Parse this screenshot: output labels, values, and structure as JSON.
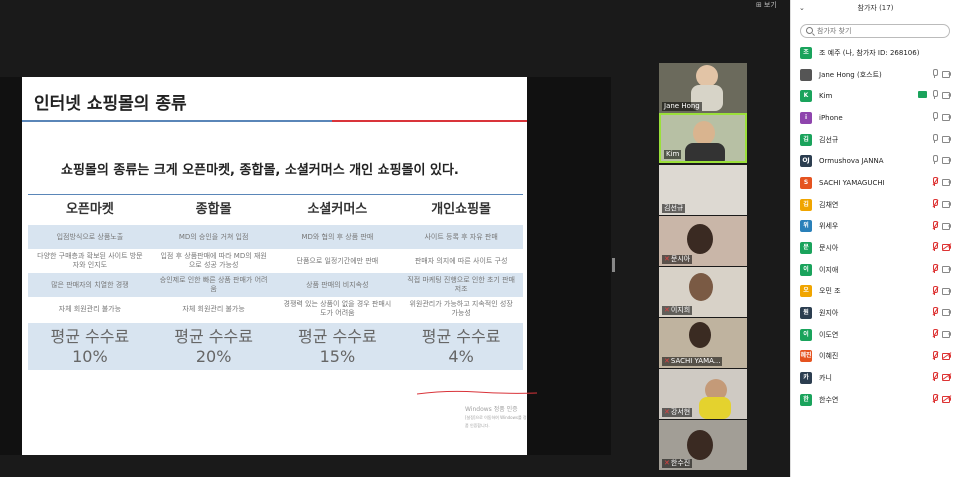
{
  "toolbar": {
    "view_label": "보기",
    "view_icon": "grid-icon"
  },
  "slide": {
    "title": "인터넷 쇼핑몰의 종류",
    "subtitle": "쇼핑몰의 종류는 크게 오픈마켓, 종합몰, 소셜커머스 개인 쇼핑몰이 있다.",
    "columns": [
      "오픈마켓",
      "종합몰",
      "소셜커머스",
      "개인쇼핑몰"
    ],
    "rows": [
      [
        "입점방식으로 상품노출",
        "MD의 승인을 거쳐 입점",
        "MD와 협의 후 상품 판매",
        "사이트 등록 후 자유 판매"
      ],
      [
        "다양한 구매층과 확보된 사이트 방문자와 인지도",
        "입점 후 상품판매에 따라 MD의 재원으로 성공 가능성",
        "단품으로 일정기간에만 판매",
        "판매자 의지에 따른 사이트 구성"
      ],
      [
        "많은 판매자의 치열한 경쟁",
        "승인제로 인한 빠른 상품 판매가 어려움",
        "상품 판매의 비지속성",
        "직접 마케팅 진행으로 인한 초기 판매 저조"
      ],
      [
        "자체 회원관리 불가능",
        "자체 회원관리 불가능",
        "경쟁력 있는 상품이 없을 경우 판매시도가 어려움",
        "위원관리가 가능하고 지속적인 성장 가능성"
      ]
    ],
    "fee_label": "평균 수수료",
    "fees": [
      "10%",
      "20%",
      "15%",
      "4%"
    ],
    "watermark_title": "Windows 정품 인증",
    "watermark_sub": "[설정]으로 이동하여 Windows를 정품 인증합니다.",
    "accent_blue": "#5a86b8",
    "accent_red": "#d9343a",
    "shade": "#d8e4f0"
  },
  "video_tiles": [
    {
      "name": "Jane Hong",
      "muted": false,
      "active": false
    },
    {
      "name": "Kim",
      "muted": false,
      "active": true
    },
    {
      "name": "김선규",
      "muted": false,
      "active": false
    },
    {
      "name": "문시아",
      "muted": true,
      "active": false
    },
    {
      "name": "이지희",
      "muted": true,
      "active": false
    },
    {
      "name": "SACHI YAMA...",
      "muted": true,
      "active": false
    },
    {
      "name": "강서현",
      "muted": true,
      "active": false
    },
    {
      "name": "한수진",
      "muted": true,
      "active": false
    }
  ],
  "panel": {
    "title": "참가자 (17)",
    "search_placeholder": "참가자 찾기",
    "participants": [
      {
        "initial": "조",
        "name": "조 예주 (나, 참가자 ID: 268106)",
        "color": "#1aa35c",
        "mic": "none",
        "cam": "none"
      },
      {
        "initial": "",
        "name": "Jane Hong (호스트)",
        "color": "#555555",
        "mic": "on",
        "cam": "on"
      },
      {
        "initial": "K",
        "name": "Kim",
        "color": "#1aa35c",
        "mic": "on",
        "cam": "on",
        "share": true
      },
      {
        "initial": "i",
        "name": "iPhone",
        "color": "#8e44ad",
        "mic": "on",
        "cam": "on"
      },
      {
        "initial": "김",
        "name": "김선규",
        "color": "#1aa35c",
        "mic": "on",
        "cam": "on"
      },
      {
        "initial": "OJ",
        "name": "Ormushova JANNA",
        "color": "#2c3e50",
        "mic": "on",
        "cam": "on"
      },
      {
        "initial": "S",
        "name": "SACHI YAMAGUCHI",
        "color": "#e55320",
        "mic": "muted",
        "cam": "on"
      },
      {
        "initial": "김",
        "name": "김채연",
        "color": "#f0a500",
        "mic": "muted",
        "cam": "on"
      },
      {
        "initial": "위",
        "name": "위세우",
        "color": "#2980b9",
        "mic": "muted",
        "cam": "on"
      },
      {
        "initial": "문",
        "name": "문시아",
        "color": "#1aa35c",
        "mic": "muted",
        "cam": "muted"
      },
      {
        "initial": "이",
        "name": "이지애",
        "color": "#1aa35c",
        "mic": "muted",
        "cam": "on"
      },
      {
        "initial": "오",
        "name": "오민 조",
        "color": "#f0a500",
        "mic": "muted",
        "cam": "on"
      },
      {
        "initial": "원",
        "name": "원지아",
        "color": "#2c3e50",
        "mic": "muted",
        "cam": "on"
      },
      {
        "initial": "이",
        "name": "이도연",
        "color": "#1aa35c",
        "mic": "muted",
        "cam": "on"
      },
      {
        "initial": "혜진",
        "name": "이혜진",
        "color": "#e55320",
        "mic": "muted",
        "cam": "muted"
      },
      {
        "initial": "카",
        "name": "카니",
        "color": "#2c3e50",
        "mic": "muted",
        "cam": "muted"
      },
      {
        "initial": "한",
        "name": "한수연",
        "color": "#1aa35c",
        "mic": "muted",
        "cam": "muted"
      }
    ]
  }
}
